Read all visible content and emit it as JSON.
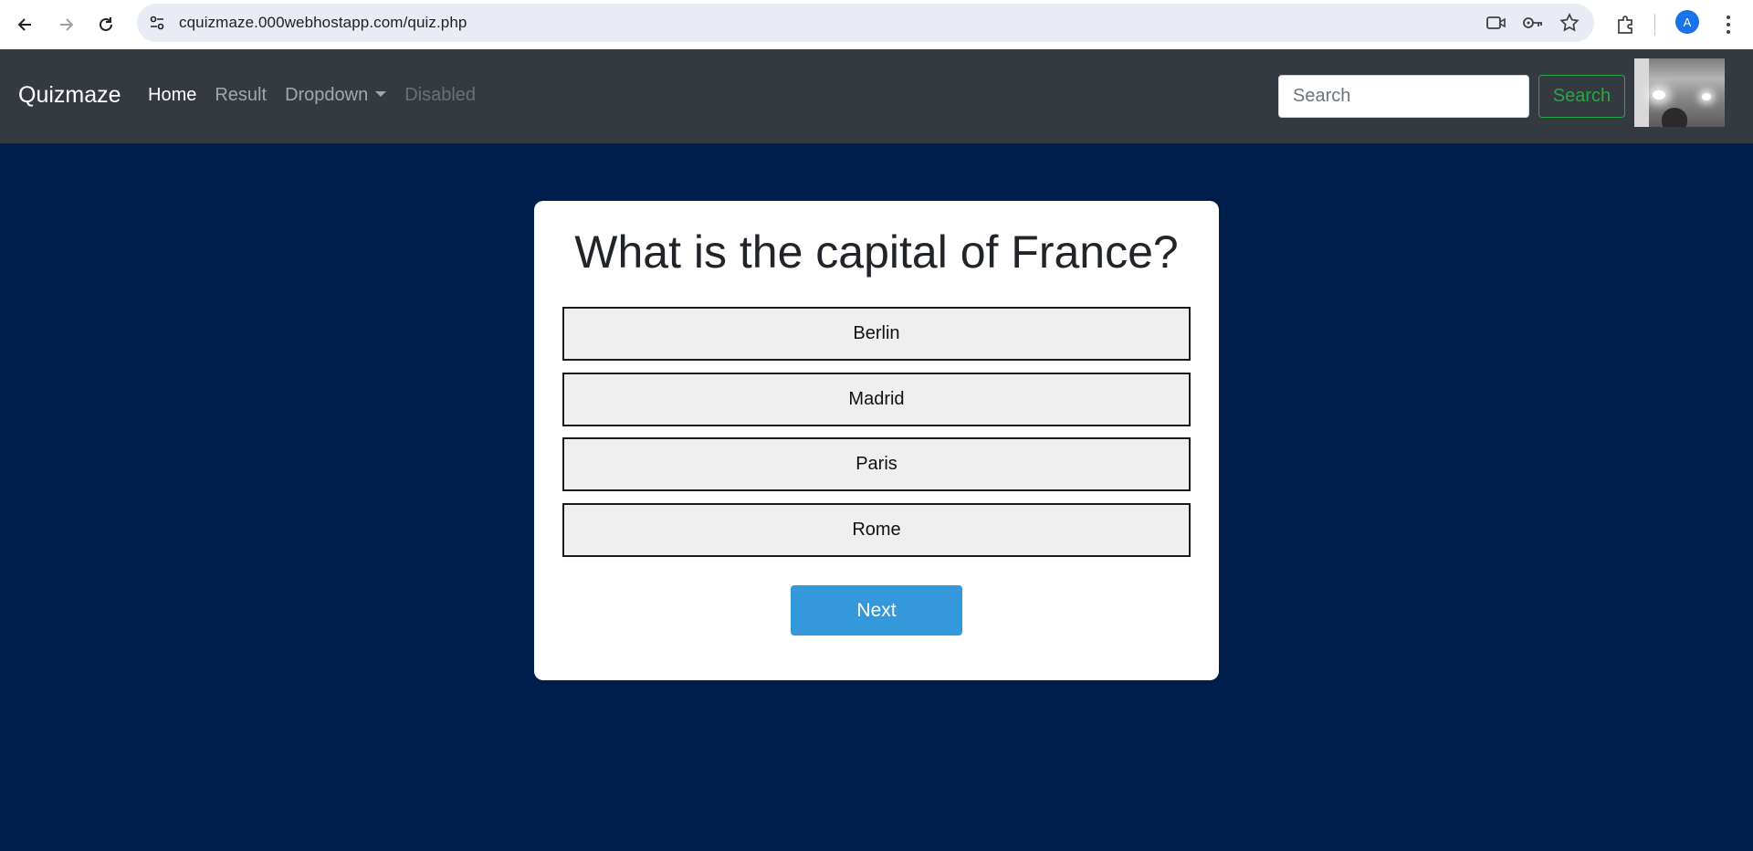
{
  "browser": {
    "url": "cquizmaze.000webhostapp.com/quiz.php",
    "profile_initial": "A",
    "icons": {
      "back": "back-arrow-icon",
      "forward": "forward-arrow-icon",
      "reload": "reload-icon",
      "site_info": "site-info-icon",
      "camera": "camera-icon",
      "password": "key-icon",
      "bookmark": "star-icon",
      "extensions": "puzzle-icon",
      "menu": "kebab-menu-icon"
    },
    "colors": {
      "avatar": "#1a73e8",
      "omnibox": "#e9ecf5"
    }
  },
  "navbar": {
    "brand": "Quizmaze",
    "links": [
      {
        "label": "Home",
        "state": "active"
      },
      {
        "label": "Result",
        "state": "normal"
      },
      {
        "label": "Dropdown",
        "state": "normal"
      },
      {
        "label": "Disabled",
        "state": "disabled"
      }
    ],
    "search": {
      "placeholder": "Search",
      "value": "",
      "button_label": "Search"
    },
    "colors": {
      "background": "#343a40",
      "search_button": "#28a745"
    }
  },
  "quiz": {
    "question": "What is the capital of France?",
    "options": [
      "Berlin",
      "Madrid",
      "Paris",
      "Rome"
    ],
    "next_label": "Next",
    "colors": {
      "page_background": "#001e4c",
      "next_button": "#3498db"
    }
  }
}
